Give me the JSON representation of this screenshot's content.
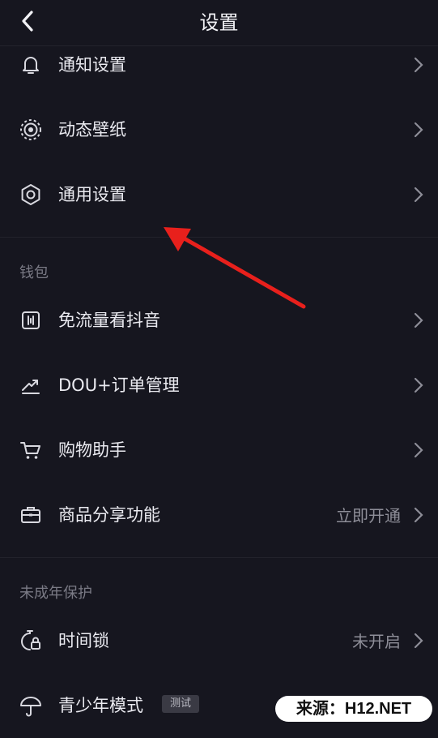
{
  "header": {
    "title": "设置"
  },
  "rows_top": [
    {
      "label": "通知设置",
      "icon": "bell-icon"
    },
    {
      "label": "动态壁纸",
      "icon": "live-wallpaper-icon"
    },
    {
      "label": "通用设置",
      "icon": "gear-icon"
    }
  ],
  "wallet": {
    "title": "钱包",
    "items": [
      {
        "label": "免流量看抖音",
        "icon": "data-free-icon"
      },
      {
        "label": "DOU+订单管理",
        "icon": "trend-icon"
      },
      {
        "label": "购物助手",
        "icon": "shopping-cart-icon"
      },
      {
        "label": "商品分享功能",
        "icon": "briefcase-icon",
        "value": "立即开通"
      }
    ]
  },
  "minor": {
    "title": "未成年保护",
    "items": [
      {
        "label": "时间锁",
        "icon": "timer-lock-icon",
        "value": "未开启"
      },
      {
        "label": "青少年模式",
        "icon": "umbrella-icon",
        "badge": "测试"
      }
    ]
  },
  "watermark": {
    "text": "来源：H12.NET"
  },
  "colors": {
    "background": "#16161f",
    "annotation_arrow": "#e8201c",
    "text": "#eaeaf0",
    "muted": "#8e8e98"
  }
}
